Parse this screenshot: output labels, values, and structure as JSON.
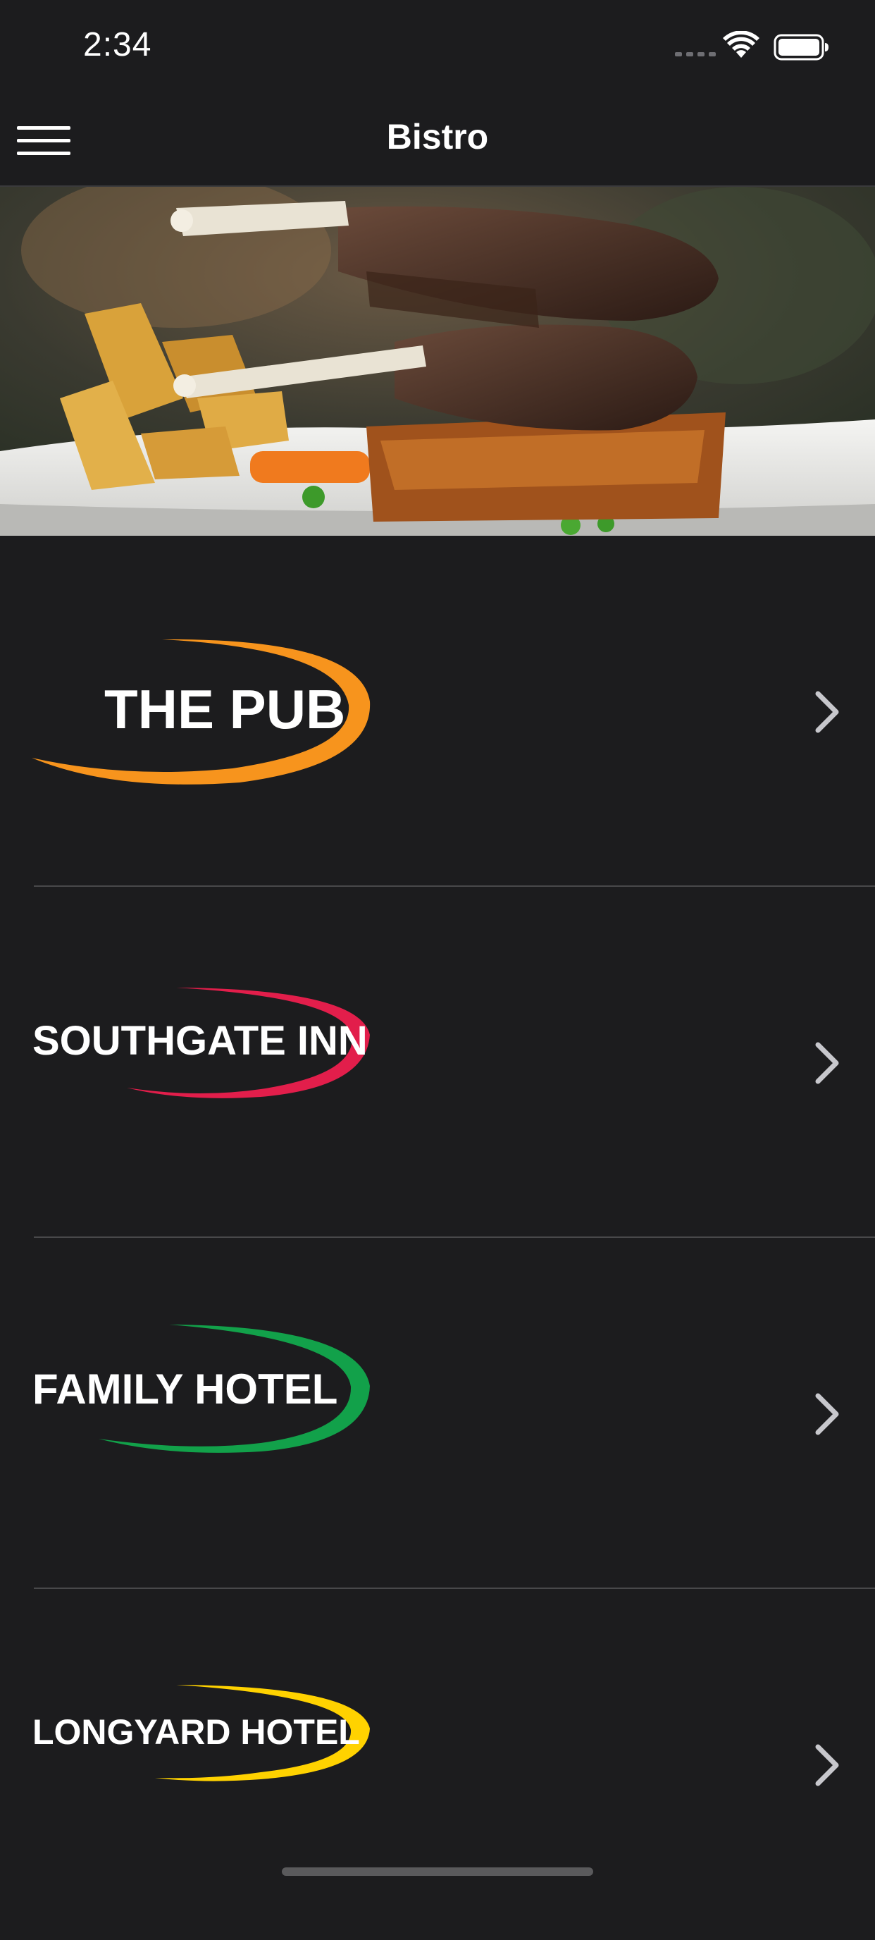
{
  "status_bar": {
    "time": "2:34"
  },
  "nav": {
    "title": "Bistro",
    "menu_icon": "hamburger-menu-icon"
  },
  "hero": {
    "icon": "food-photo-lamb-chops"
  },
  "venues": [
    {
      "name": "THE PUB",
      "accent": "#f7941d"
    },
    {
      "name": "SOUTHGATE INN",
      "accent": "#e21e4b"
    },
    {
      "name": "FAMILY HOTEL",
      "accent": "#12a14a"
    },
    {
      "name": "LONGYARD HOTEL",
      "accent": "#ffd200"
    }
  ],
  "colors": {
    "background": "#1c1c1e",
    "divider": "#48484a",
    "chevron": "#c7c7cc"
  }
}
